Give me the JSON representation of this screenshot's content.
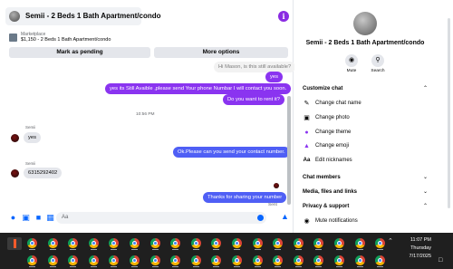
{
  "chat": {
    "title": "Semii - 2 Beds 1 Bath Apartment/condo",
    "marketplace_label": "Marketplace",
    "listing": "$1,150 - 2 Beds 1 Bath Apartment/condo",
    "mark_pending": "Mark as pending",
    "more_options": "More options",
    "messages": [
      {
        "text": "Hi Mason, is this still available?",
        "kind": "faded"
      },
      {
        "text": "yes",
        "kind": "out"
      },
      {
        "text": "yes its Still Avaible ,please send Your phone Numbar I will contact you soon.",
        "kind": "out"
      },
      {
        "text": "Do you want to rent it?",
        "kind": "out"
      },
      {
        "text": "10:56 PM",
        "kind": "time"
      },
      {
        "sender": "Semii",
        "text": "yes",
        "kind": "in"
      },
      {
        "text": "Ok.Please can you send your contact number.",
        "kind": "out-blue"
      },
      {
        "sender": "Semii",
        "text": "6315292402",
        "kind": "in"
      },
      {
        "text": "Thanks for sharing your number",
        "kind": "out-blue"
      },
      {
        "text": "Sent",
        "kind": "status"
      }
    ],
    "composer_placeholder": "Aa"
  },
  "side": {
    "name": "Semii - 2 Beds 1 Bath Apartment/condo",
    "mute_label": "Mute",
    "search_label": "Search",
    "customize_title": "Customize chat",
    "customize_items": [
      "Change chat name",
      "Change photo",
      "Change theme",
      "Change emoji",
      "Edit nicknames"
    ],
    "chat_members": "Chat members",
    "media": "Media, files and links",
    "privacy": "Privacy & support",
    "mute_notifications": "Mute notifications"
  },
  "taskbar": {
    "time": "11:07 PM",
    "day": "Thursday",
    "date": "7/17/2025"
  },
  "colors": {
    "outgoing": "#8a34f0",
    "outgoing_blue": "#4f5ff5",
    "accent": "#0866ff"
  }
}
